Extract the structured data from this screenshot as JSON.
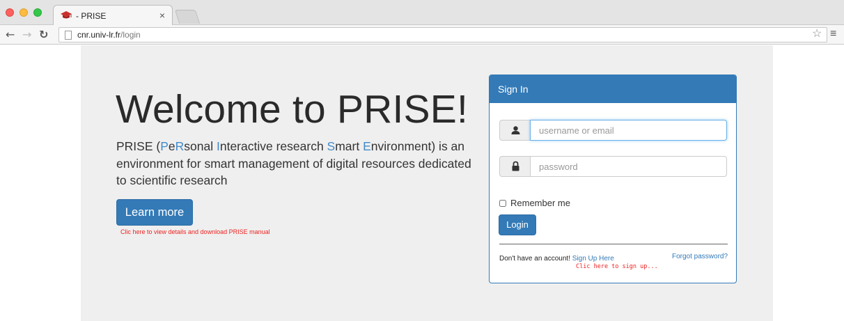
{
  "browser": {
    "tab_title": "- PRISE",
    "tab_close": "×",
    "url_host": "cnr.univ-lr.fr",
    "url_path": "/login",
    "icons": {
      "back": "arrow-left-icon",
      "forward": "arrow-right-icon",
      "reload": "reload-icon",
      "bookmark": "star-icon",
      "menu": "hamburger-menu-icon",
      "favicon": "graduation-cap-icon"
    }
  },
  "hero": {
    "title": "Welcome to PRISE!",
    "desc": {
      "p1": "PRISE (",
      "h1": "P",
      "p2": "e",
      "h2": "R",
      "p3": "sonal ",
      "h3": "I",
      "p4": "nteractive research ",
      "h4": "S",
      "p5": "mart ",
      "h5": "E",
      "p6": "nvironment) is an environment for smart management of digital resources dedicated to scientific research"
    },
    "learn_more": "Learn more",
    "learn_note": "Clic here to  view details and download PRISE manual"
  },
  "signin": {
    "heading": "Sign In",
    "username_placeholder": "username or email",
    "password_placeholder": "password",
    "remember_me": "Remember me",
    "login": "Login",
    "no_account": "Don't have an account! ",
    "sign_up": "Sign Up Here",
    "forgot": "Forgot password?",
    "signup_note": "Clic here to sign up...",
    "icons": {
      "user": "user-icon",
      "password": "lock-icon"
    }
  },
  "colors": {
    "primary": "#337ab7",
    "highlight_letters": "#428bca",
    "note_red": "#ee2222",
    "page_bg": "#efefef"
  }
}
